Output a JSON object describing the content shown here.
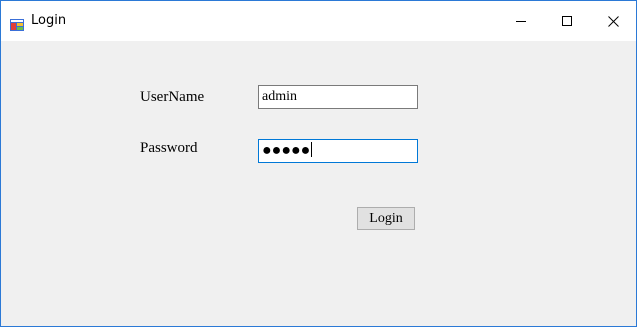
{
  "window": {
    "title": "Login",
    "app_icon": "winforms-app-icon",
    "controls": {
      "minimize_icon": "minimize-icon",
      "maximize_icon": "maximize-icon",
      "close_icon": "close-icon"
    },
    "accent_color": "#2b79d6"
  },
  "form": {
    "username_label": "UserName",
    "username_value": "admin",
    "password_label": "Password",
    "password_masked": "●●●●●",
    "login_label": "Login"
  }
}
